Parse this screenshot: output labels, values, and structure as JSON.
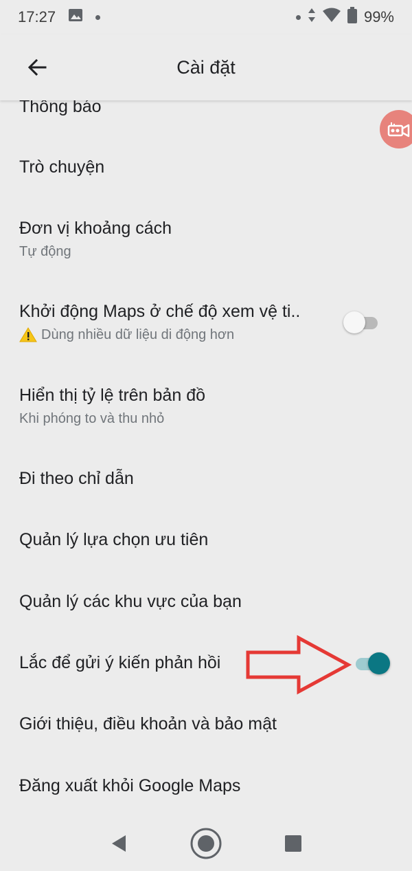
{
  "status_bar": {
    "time": "17:27",
    "battery": "99%",
    "icons": [
      "gallery-icon",
      "notification-dot",
      "data-arrows-icon",
      "wifi-icon",
      "battery-icon"
    ]
  },
  "app_bar": {
    "title": "Cài đặt",
    "back_icon": "arrow-back-icon"
  },
  "settings": [
    {
      "title": "Thông báo"
    },
    {
      "title": "Trò chuyện"
    },
    {
      "title": "Đơn vị khoảng cách",
      "subtitle": "Tự động"
    },
    {
      "title": "Khởi động Maps ở chế độ xem vệ ti..",
      "subtitle": "Dùng nhiều dữ liệu di động hơn",
      "toggle": "off",
      "warning_icon": "warning-icon"
    },
    {
      "title": "Hiển thị tỷ lệ trên bản đồ",
      "subtitle": "Khi phóng to và thu nhỏ"
    },
    {
      "title": "Đi theo chỉ dẫn"
    },
    {
      "title": "Quản lý lựa chọn ưu tiên"
    },
    {
      "title": "Quản lý các khu vực của bạn"
    },
    {
      "title": "Lắc để gửi ý kiến phản hồi",
      "toggle": "on"
    },
    {
      "title": "Giới thiệu, điều khoản và bảo mật"
    },
    {
      "title": "Đăng xuất khỏi Google Maps"
    }
  ],
  "colors": {
    "background": "#ececec",
    "toggle_on_thumb": "#0b7783",
    "toggle_on_track": "#9ecbd0",
    "annotation_arrow": "#e53935",
    "fab": "#e7837c"
  },
  "nav_bar": {
    "icons": [
      "back-triangle-icon",
      "home-circle-icon",
      "recents-square-icon"
    ]
  }
}
